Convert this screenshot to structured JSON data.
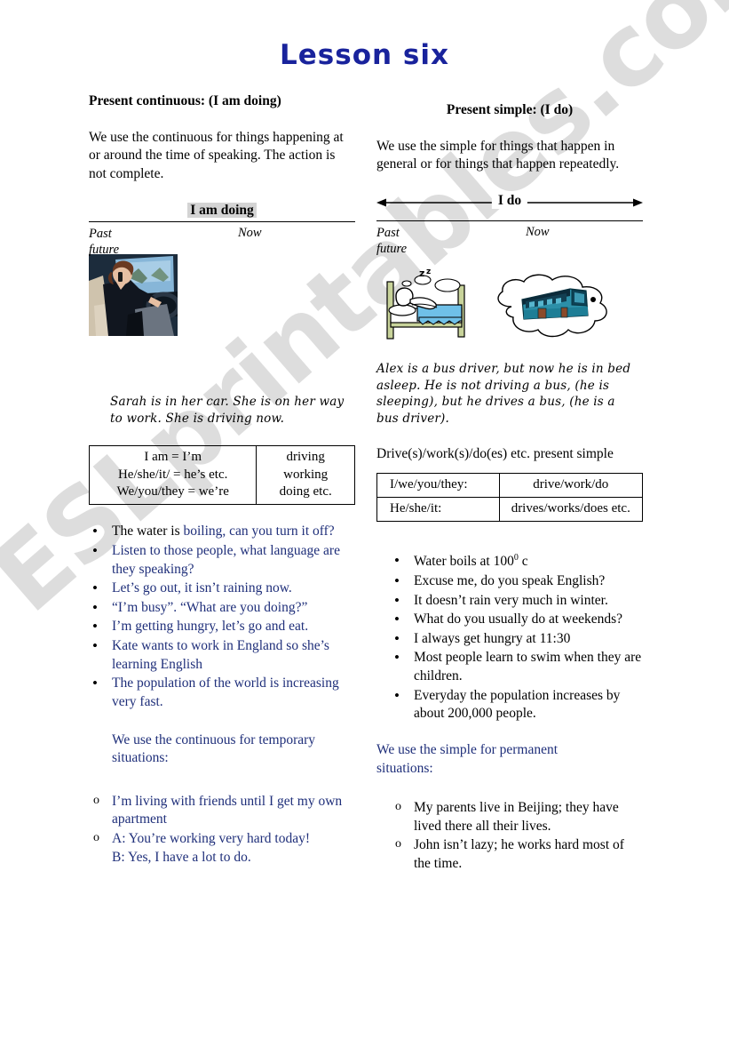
{
  "watermark": {
    "text": "ESLprintables.com"
  },
  "title": "Lesson six",
  "left": {
    "heading": "Present continuous:  (I am doing)",
    "intro": "We use the continuous for things happening at or around the time of speaking. The action is not complete.",
    "timeline": {
      "label": "I am doing",
      "past": "Past",
      "future": "future",
      "now": "Now"
    },
    "image_alt": "woman-driving-car-photo",
    "caption": "Sarah is in her car. She is on her way to work. She is driving now.",
    "table": {
      "left_lines": [
        "I am = I’m",
        "He/she/it/ = he’s etc.",
        "We/you/they = we’re"
      ],
      "right_lines": [
        "driving",
        "working",
        "doing etc."
      ]
    },
    "examples": [
      {
        "pre": "The water is ",
        "hl": "boiling",
        "post": ", can you turn it off?"
      },
      {
        "pre": "",
        "hl": "",
        "post": "Listen to those people, what language are they speaking?"
      },
      {
        "pre": "",
        "hl": "",
        "post": "Let’s go out, it isn’t raining now."
      },
      {
        "pre": "",
        "hl": "",
        "post": "“I’m busy”. “What are you doing?”"
      },
      {
        "pre": "",
        "hl": "",
        "post": "I’m getting hungry, let’s go and eat."
      },
      {
        "pre": "",
        "hl": "",
        "post": "Kate wants to work in England so she’s learning English"
      },
      {
        "pre": "",
        "hl": "",
        "post": "The population of the world is increasing very fast."
      }
    ],
    "note": "We use the continuous for temporary situations:",
    "sub_examples": [
      "I’m living with friends until I get my own apartment",
      "A:  You’re working very hard today!\nB:    Yes, I have a lot to do."
    ]
  },
  "right": {
    "heading": "Present simple: (I do)",
    "intro": "We use the simple for things that happen in general or for things that happen repeatedly.",
    "timeline": {
      "label": "I do",
      "past": "Past",
      "future": "future",
      "now": "Now"
    },
    "image_alt": "man-asleep-in-bed-dreaming-of-bus-clipart",
    "caption": "Alex is a bus driver, but now he is in bed asleep. He is not driving a bus, (he is sleeping), but he drives a bus, (he is a bus driver).",
    "pre_table_line": "Drive(s)/work(s)/do(es) etc. present simple",
    "table": {
      "rows": [
        {
          "subject": "I/we/you/they:",
          "forms": "drive/work/do"
        },
        {
          "subject": "He/she/it:",
          "forms": "drives/works/does etc."
        }
      ]
    },
    "examples": [
      {
        "text": "Water boils at 100",
        "sup": "0",
        "tail": " c"
      },
      {
        "text": "Excuse me, do you speak English?",
        "sup": "",
        "tail": ""
      },
      {
        "text": "It doesn’t rain very much in winter.",
        "sup": "",
        "tail": ""
      },
      {
        "text": "What do you usually do at weekends?",
        "sup": "",
        "tail": ""
      },
      {
        "text": "I always get hungry at 11:30",
        "sup": "",
        "tail": ""
      },
      {
        "text": "Most people learn to swim when they are children.",
        "sup": "",
        "tail": ""
      },
      {
        "text": "Everyday the population increases by about 200,000 people.",
        "sup": "",
        "tail": ""
      }
    ],
    "note": "We use the simple for permanent situations:",
    "sub_examples": [
      "My parents live in Beijing; they have lived there all their lives.",
      "John isn’t lazy; he works hard most of the time."
    ]
  },
  "colors": {
    "title": "#19239c",
    "blue_text": "#1f2f7a",
    "highlight": "#d4d4d4",
    "watermark": "#c9c9c9"
  }
}
